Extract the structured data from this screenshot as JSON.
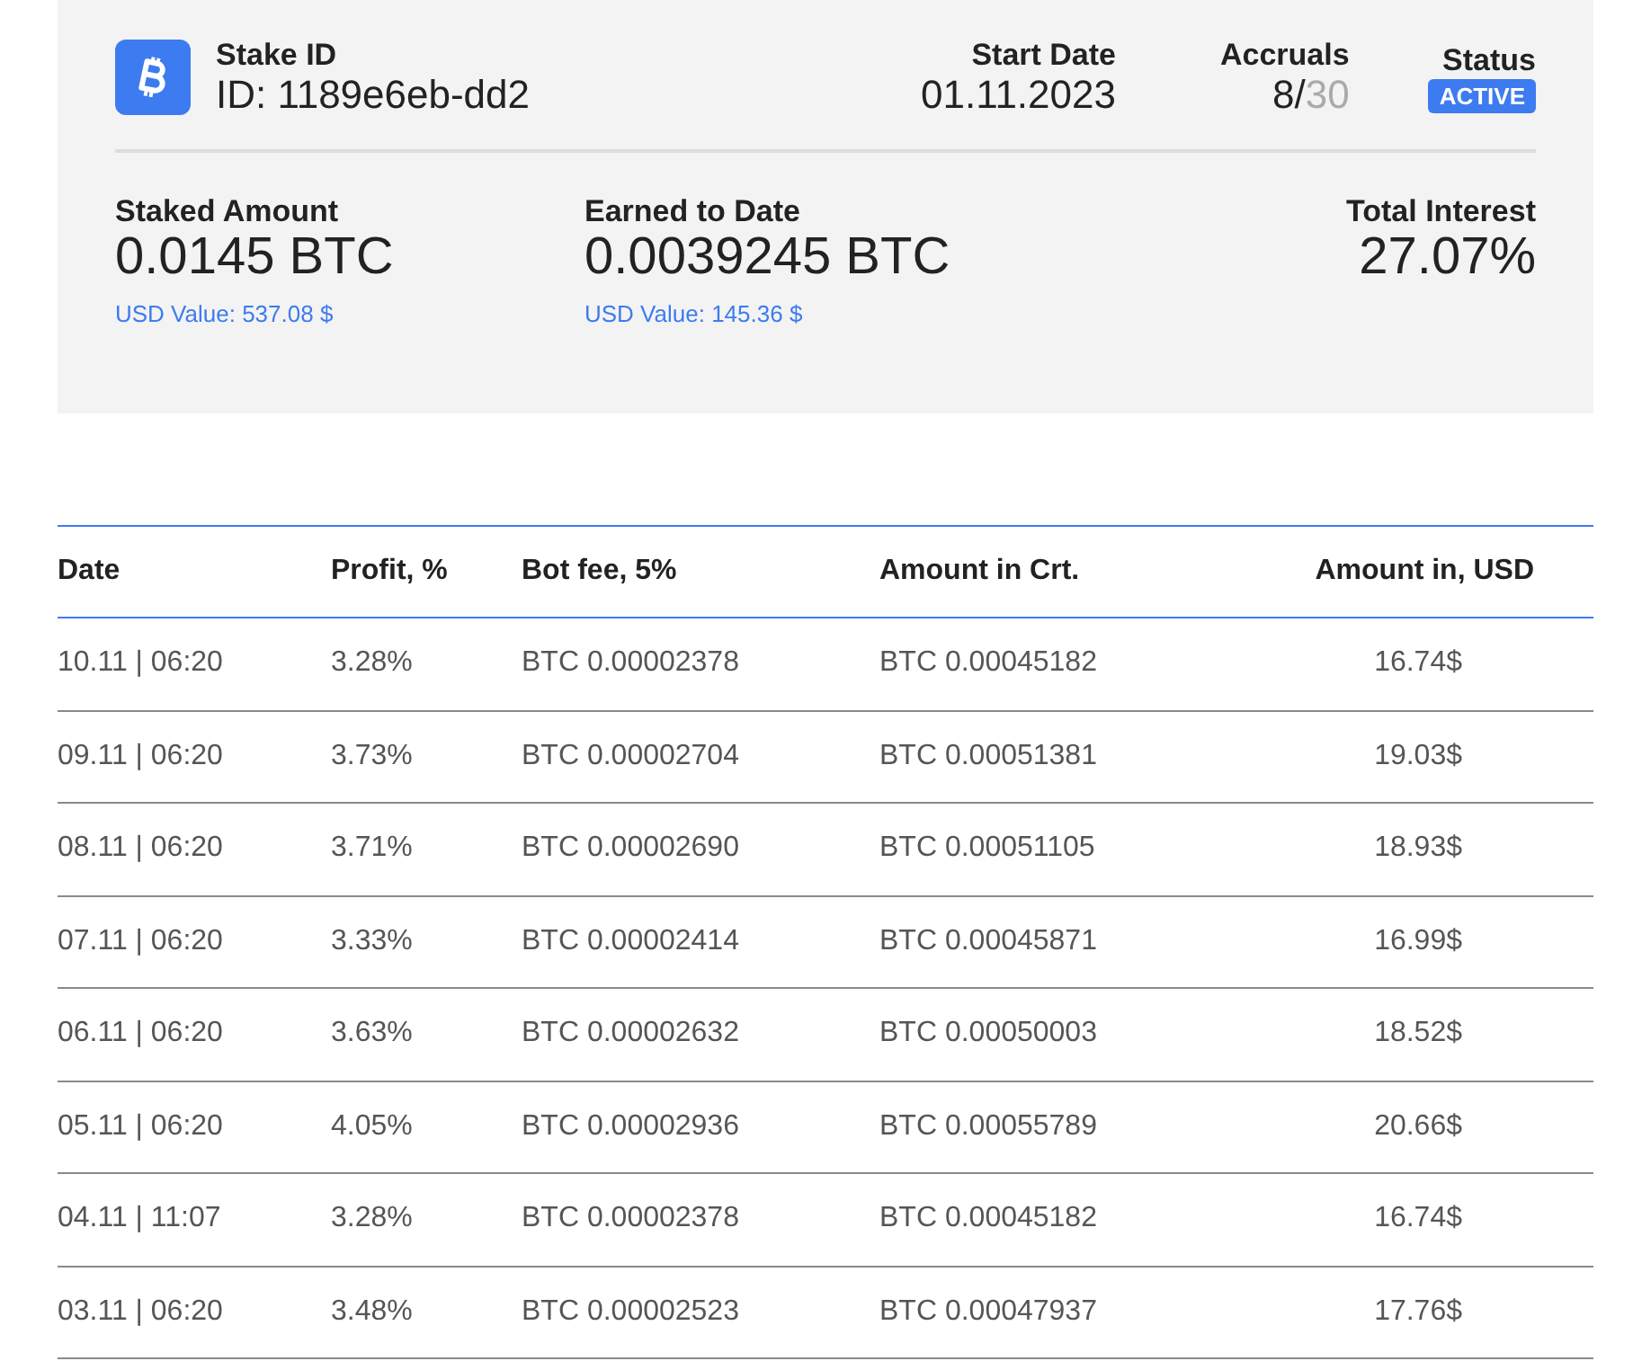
{
  "stake": {
    "label": "Stake ID",
    "id": "ID: 1189e6eb-dd2",
    "start_date": {
      "label": "Start Date",
      "value": "01.11.2023"
    },
    "accruals": {
      "label": "Accruals",
      "done": "8/",
      "total": "30"
    },
    "status": {
      "label": "Status",
      "badge": "ACTIVE"
    }
  },
  "summary": [
    {
      "label": "Staked Amount",
      "value": "0.0145 BTC",
      "usd": "USD Value: 537.08 $"
    },
    {
      "label": "Earned to Date",
      "value": "0.0039245 BTC",
      "usd": "USD Value: 145.36 $"
    },
    {
      "label": "Total Interest",
      "value": "27.07%"
    }
  ],
  "table": {
    "columns": [
      "Date",
      "Profit, %",
      "Bot fee, 5%",
      "Amount in Crt.",
      "Amount in, USD"
    ],
    "rows": [
      [
        "10.11 | 06:20",
        "3.28%",
        "BTC 0.00002378",
        "BTC 0.00045182",
        "16.74$"
      ],
      [
        "09.11 | 06:20",
        "3.73%",
        "BTC 0.00002704",
        "BTC 0.00051381",
        "19.03$"
      ],
      [
        "08.11 | 06:20",
        "3.71%",
        "BTC 0.00002690",
        "BTC 0.00051105",
        "18.93$"
      ],
      [
        "07.11 | 06:20",
        "3.33%",
        "BTC 0.00002414",
        "BTC 0.00045871",
        "16.99$"
      ],
      [
        "06.11 | 06:20",
        "3.63%",
        "BTC 0.00002632",
        "BTC 0.00050003",
        "18.52$"
      ],
      [
        "05.11 | 06:20",
        "4.05%",
        "BTC 0.00002936",
        "BTC 0.00055789",
        "20.66$"
      ],
      [
        "04.11 | 11:07",
        "3.28%",
        "BTC 0.00002378",
        "BTC 0.00045182",
        "16.74$"
      ],
      [
        "03.11 | 06:20",
        "3.48%",
        "BTC 0.00002523",
        "BTC 0.00047937",
        "17.76$"
      ]
    ]
  }
}
